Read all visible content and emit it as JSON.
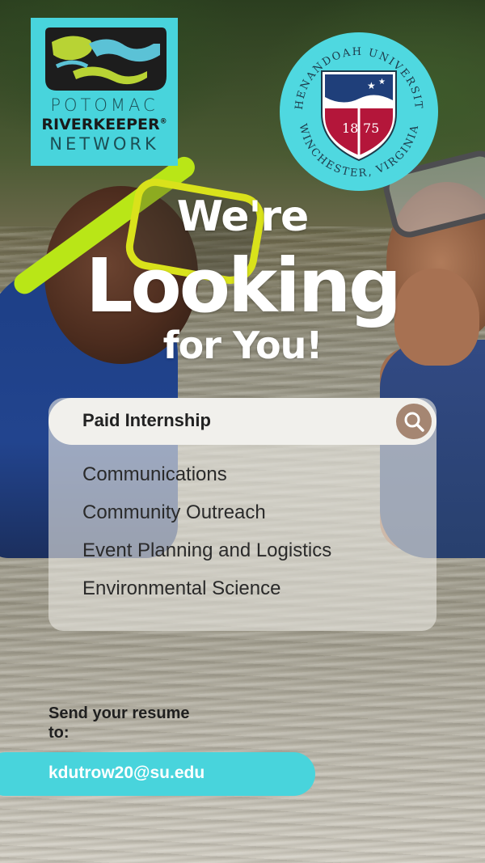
{
  "logos": {
    "potomac": {
      "line1": "POTOMAC",
      "line2": "RIVERKEEPER",
      "registered": "®",
      "line3": "NETWORK"
    },
    "shenandoah": {
      "top_text": "SHENANDOAH UNIVERSITY",
      "bottom_text": "WINCHESTER, VIRGINIA",
      "year_left": "18",
      "year_right": "75"
    }
  },
  "headline": {
    "line1": "We're",
    "line2": "Looking",
    "line3": "for You!"
  },
  "search": {
    "value": "Paid Internship",
    "icon": "search-icon"
  },
  "roles": [
    "Communications",
    "Community Outreach",
    "Event Planning and Logistics",
    "Environmental Science"
  ],
  "contact": {
    "prompt": "Send your resume to:",
    "email": "kdutrow20@su.edu"
  },
  "colors": {
    "accent": "#48d4dc",
    "search_button": "#a58672",
    "snorkel": "#b9e617"
  }
}
